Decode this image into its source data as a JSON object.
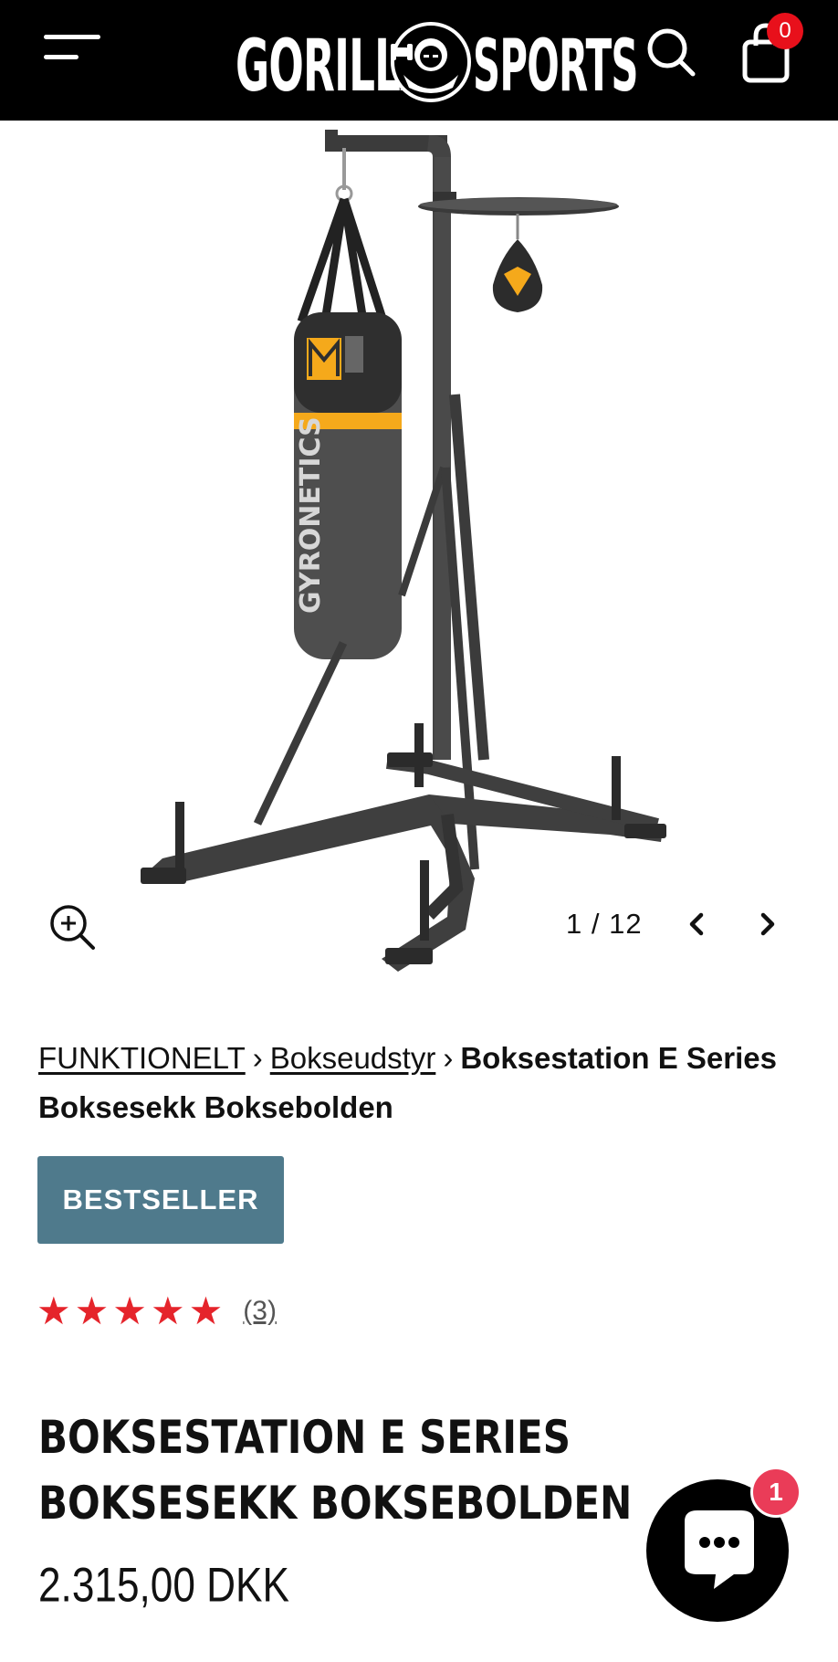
{
  "header": {
    "logo_left": "GORILLA",
    "logo_right": "SPORTS",
    "cart_count": "0",
    "icons": {
      "menu": "hamburger-menu-icon",
      "search": "search-icon",
      "cart": "shopping-bag-icon"
    }
  },
  "gallery": {
    "counter": "1 / 12",
    "product_logo_text": "GYRONETICS",
    "icons": {
      "zoom": "zoom-in-icon",
      "prev": "chevron-left-icon",
      "next": "chevron-right-icon"
    }
  },
  "breadcrumb": {
    "items": [
      "FUNKTIONELT",
      "Bokseudstyr"
    ],
    "separator": "›",
    "current": "Boksestation E Series Boksesekk Boksebolden"
  },
  "product": {
    "badge": "BESTSELLER",
    "stars": "★★★★★",
    "review_count": "(3)",
    "title": "BOKSESTATION E SERIES BOKSESEKK BOKSEBOLDEN",
    "price": "2.315,00 DKK"
  },
  "chat": {
    "badge": "1",
    "icon": "chat-bubble-icon"
  },
  "colors": {
    "header_bg": "#000000",
    "badge_bg": "#4f7a8c",
    "star": "#e5242b",
    "cart_badge": "#e8101b",
    "chat_badge": "#ea3c58",
    "bag_accent": "#f5a91b"
  }
}
